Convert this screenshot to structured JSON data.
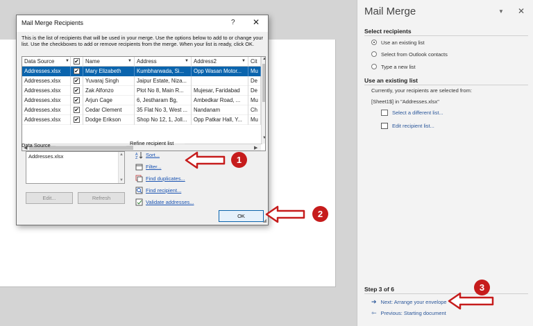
{
  "dialog": {
    "title": "Mail Merge Recipients",
    "help": "?",
    "close": "✕",
    "description": "This is the list of recipients that will be used in your merge.  Use the options below to add to or change your list.  Use the checkboxes to add or remove recipients from the merge.  When your list is ready, click OK.",
    "columns": [
      "Data Source",
      "✔",
      "Name",
      "Address",
      "Address2",
      "Cit"
    ],
    "rows": [
      {
        "source": "Addresses.xlsx",
        "check": "✔",
        "name": "Mary Elizabeth",
        "address": "Kumbharwada, Si...",
        "address2": "Opp Wasan Motor...",
        "city": "Mu",
        "selected": true
      },
      {
        "source": "Addresses.xlsx",
        "check": "✔",
        "name": "Yuvaraj Singh",
        "address": "Jaipur Estate, Niza...",
        "address2": "",
        "city": "De",
        "selected": false
      },
      {
        "source": "Addresses.xlsx",
        "check": "✔",
        "name": "Zak Alfonzo",
        "address": "Plot No 8, Main R...",
        "address2": "Mujesar, Faridabad",
        "city": "De",
        "selected": false
      },
      {
        "source": "Addresses.xlsx",
        "check": "✔",
        "name": "Arjun Cage",
        "address": "6, Jestharam Bg,",
        "address2": "Ambedkar Road, ...",
        "city": "Mu",
        "selected": false
      },
      {
        "source": "Addresses.xlsx",
        "check": "✔",
        "name": "Cedar Clement",
        "address": "35 Flat No 3, West ...",
        "address2": "Nandanam",
        "city": "Ch",
        "selected": false
      },
      {
        "source": "Addresses.xlsx",
        "check": "✔",
        "name": "Dodge Erikson",
        "address": "Shop No 12, 1, Joll...",
        "address2": "Opp Patkar Hall, Y...",
        "city": "Mu",
        "selected": false
      }
    ],
    "data_source_label": "Data Source",
    "data_source_item": "Addresses.xlsx",
    "edit_button": "Edit...",
    "refresh_button": "Refresh",
    "refine_label": "Refine recipient list",
    "refine_links": [
      "Sort...",
      "Filter...",
      "Find duplicates...",
      "Find recipient...",
      "Validate addresses..."
    ],
    "ok_button": "OK"
  },
  "pane": {
    "title": "Mail Merge",
    "select_heading": "Select recipients",
    "options": [
      {
        "label": "Use an existing list",
        "checked": true
      },
      {
        "label": "Select from Outlook contacts",
        "checked": false
      },
      {
        "label": "Type a new list",
        "checked": false
      }
    ],
    "existing_heading": "Use an existing list",
    "current_text": "Currently, your recipients are selected from:",
    "current_source": "[Sheet1$] in \"Addresses.xlsx\"",
    "select_different": "Select a different list...",
    "edit_list": "Edit recipient list...",
    "step_label": "Step 3 of 6",
    "next_link": "Next: Arrange your envelope",
    "prev_link": "Previous: Starting document"
  },
  "badges": [
    "1",
    "2",
    "3"
  ],
  "colors": {
    "accent": "#0a64ad",
    "link": "#2b579a",
    "annotation": "#c61c1c"
  }
}
